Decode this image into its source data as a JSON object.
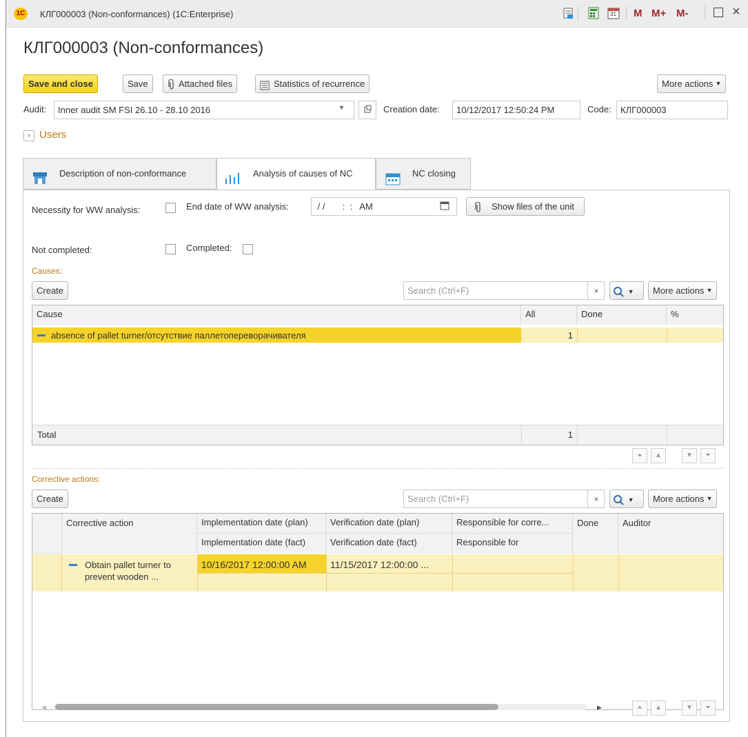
{
  "window": {
    "title": "КЛГ000003 (Non-conformances)  (1C:Enterprise)",
    "logo_text": "1С",
    "buttons": {
      "m": "M",
      "m_plus": "M+",
      "m_minus": "M-",
      "calendar_day": "31",
      "restore": "□",
      "close": "×"
    }
  },
  "page": {
    "title": "КЛГ000003 (Non-conformances)"
  },
  "toolbar": {
    "save_and_close": "Save and close",
    "save": "Save",
    "attached_files": "Attached files",
    "statistics": "Statistics of recurrence",
    "more_actions": "More actions"
  },
  "header_fields": {
    "audit_label": "Audit:",
    "audit_value": "Inner audit SM FSI 26.10 - 28.10 2016",
    "creation_date_label": "Creation date:",
    "creation_date_value": "10/12/2017 12:50:24 PM",
    "code_label": "Code:",
    "code_value": "КЛГ000003",
    "users_label": "Users"
  },
  "tabs": [
    {
      "label": "Description of non-conformance",
      "icon": "shop-icon"
    },
    {
      "label": "Analysis of causes of NC",
      "icon": "bar-chart-icon",
      "active": true
    },
    {
      "label": "NC closing",
      "icon": "calendar-icon"
    }
  ],
  "analysis": {
    "necessity_label": "Necessity for WW analysis:",
    "end_date_label": "End date of WW analysis:",
    "end_date_value": " / /       :  :   AM",
    "show_files": "Show files of the unit",
    "not_completed_label": "Not completed:",
    "completed_label": "Completed:"
  },
  "causes": {
    "section_label": "Causes:",
    "create": "Create",
    "search_placeholder": "Search (Ctrl+F)",
    "clear": "×",
    "more_actions": "More actions",
    "columns": [
      "Cause",
      "All",
      "Done",
      "%"
    ],
    "rows": [
      {
        "cause": "absence of pallet turner/отсутствие паллетопереворачивателя",
        "all": "1",
        "done": "",
        "percent": ""
      }
    ],
    "total_label": "Total",
    "total_all": "1"
  },
  "corrective": {
    "section_label": "Corrective actions:",
    "create": "Create",
    "search_placeholder": "Search (Ctrl+F)",
    "clear": "×",
    "more_actions": "More actions",
    "columns_top": [
      "Corrective action",
      "Implementation date (plan)",
      "Verification date (plan)",
      "Responsible for corre...",
      "Done",
      "Auditor"
    ],
    "columns_bottom": [
      "Implementation date (fact)",
      "Verification date (fact)",
      "Responsible for"
    ],
    "rows": [
      {
        "action_line1": "Obtain pallet turner to",
        "action_line2": "prevent wooden ...",
        "impl_plan": "10/16/2017 12:00:00 AM",
        "verif_plan": "11/15/2017 12:00:00 ..."
      }
    ]
  }
}
